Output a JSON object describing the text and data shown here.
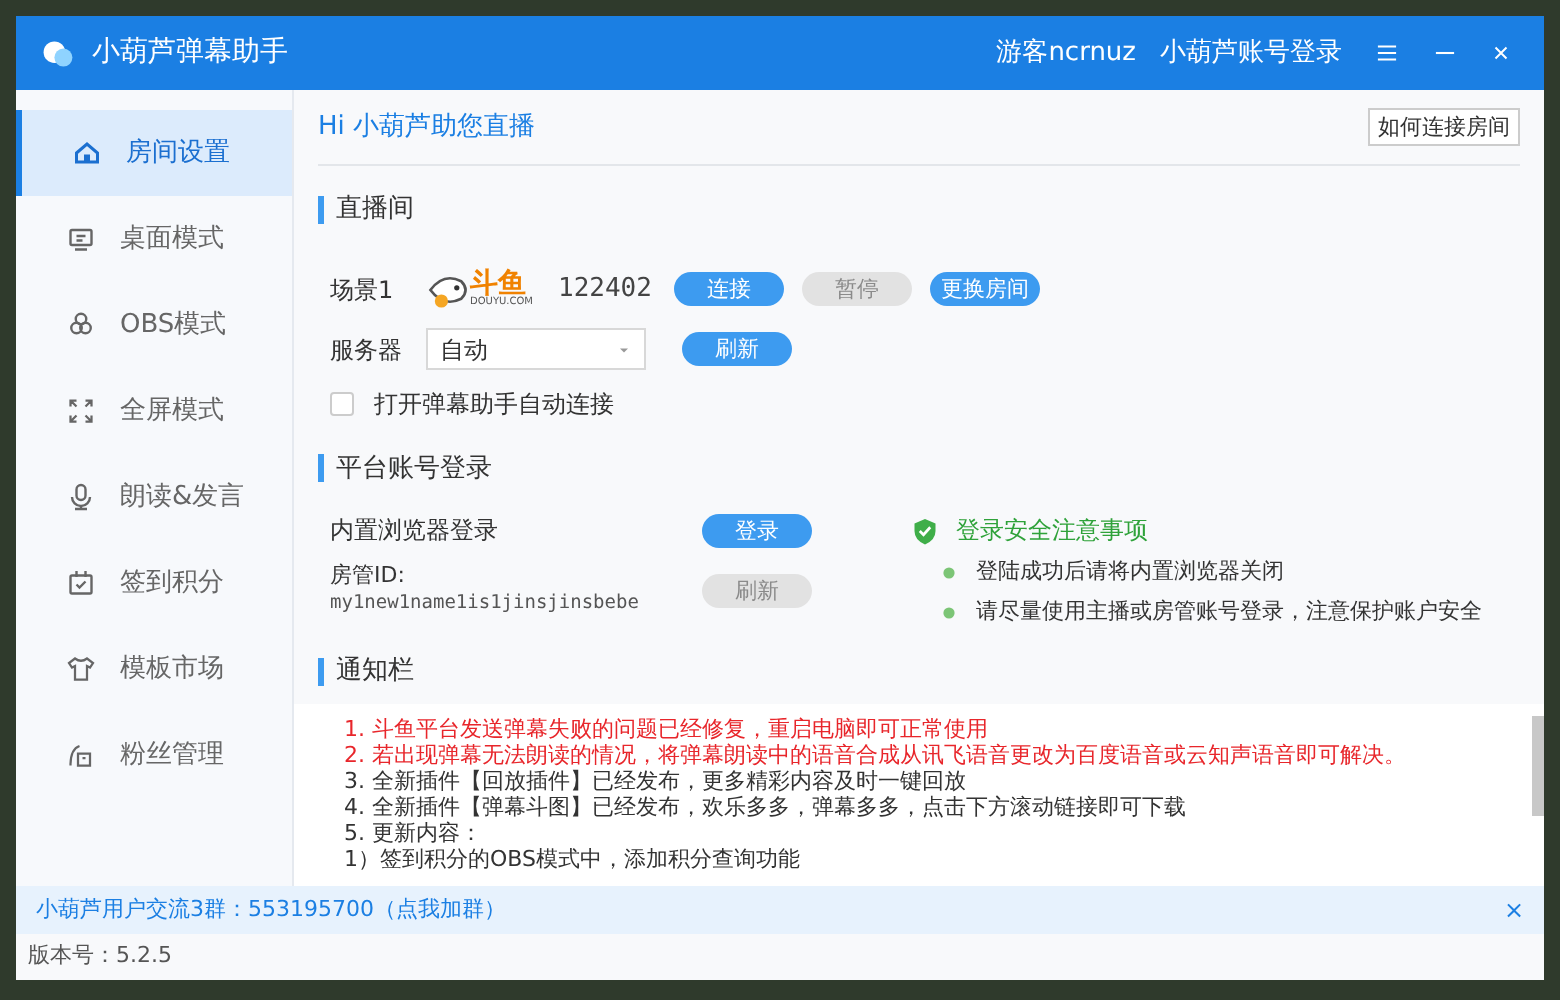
{
  "window": {
    "title": "小葫芦弹幕助手",
    "user": "游客ncrnuz",
    "login_link": "小葫芦账号登录"
  },
  "sidebar": {
    "items": [
      {
        "label": "房间设置",
        "selected": true
      },
      {
        "label": "桌面模式",
        "selected": false
      },
      {
        "label": "OBS模式",
        "selected": false
      },
      {
        "label": "全屏模式",
        "selected": false
      },
      {
        "label": "朗读&发言",
        "selected": false
      },
      {
        "label": "签到积分",
        "selected": false
      },
      {
        "label": "模板市场",
        "selected": false
      },
      {
        "label": "粉丝管理",
        "selected": false
      }
    ]
  },
  "header": {
    "greeting": "Hi 小葫芦助您直播",
    "help_button": "如何连接房间"
  },
  "live_room": {
    "title": "直播间",
    "scene_label": "场景1",
    "logo": {
      "name": "斗鱼",
      "domain": "DOUYU.COM"
    },
    "room_id": "122402",
    "buttons": [
      {
        "label": "连接",
        "disabled": false
      },
      {
        "label": "暂停",
        "disabled": true
      },
      {
        "label": "更换房间",
        "disabled": false
      }
    ],
    "server_label": "服务器",
    "server_value": "自动",
    "refresh_button": {
      "label": "刷新",
      "disabled": false
    },
    "auto_connect": {
      "label": "打开弹幕助手自动连接",
      "checked": false
    }
  },
  "account": {
    "title": "平台账号登录",
    "browser_label": "内置浏览器登录",
    "login_button": {
      "label": "登录",
      "disabled": false
    },
    "admin_label": "房管ID:",
    "admin_id": "my1new1name1is1jinsjinsbebe",
    "admin_refresh": {
      "label": "刷新",
      "disabled": true
    },
    "security_title": "登录安全注意事项",
    "security_tips": [
      "登陆成功后请将内置浏览器关闭",
      "请尽量使用主播或房管账号登录，注意保护账户安全"
    ]
  },
  "notice": {
    "title": "通知栏",
    "lines": [
      {
        "text": "1. 斗鱼平台发送弹幕失败的问题已经修复，重启电脑即可正常使用",
        "color": "#e8262b"
      },
      {
        "text": "2. 若出现弹幕无法朗读的情况，将弹幕朗读中的语音合成从讯飞语音更改为百度语音或云知声语音即可解决。",
        "color": "#e8262b"
      },
      {
        "text": "3. 全新插件【回放插件】已经发布，更多精彩内容及时一键回放",
        "color": "#333333"
      },
      {
        "text": "4. 全新插件【弹幕斗图】已经发布，欢乐多多，弹幕多多，点击下方滚动链接即可下载",
        "color": "#333333"
      },
      {
        "text": "5. 更新内容：",
        "color": "#333333"
      },
      {
        "text": "1）签到积分的OBS模式中，添加积分查询功能",
        "color": "#333333"
      }
    ]
  },
  "banner": {
    "text": "小葫芦用户交流3群：553195700（点我加群）",
    "close": "×"
  },
  "status_bar": {
    "version": "版本号：5.2.5"
  }
}
